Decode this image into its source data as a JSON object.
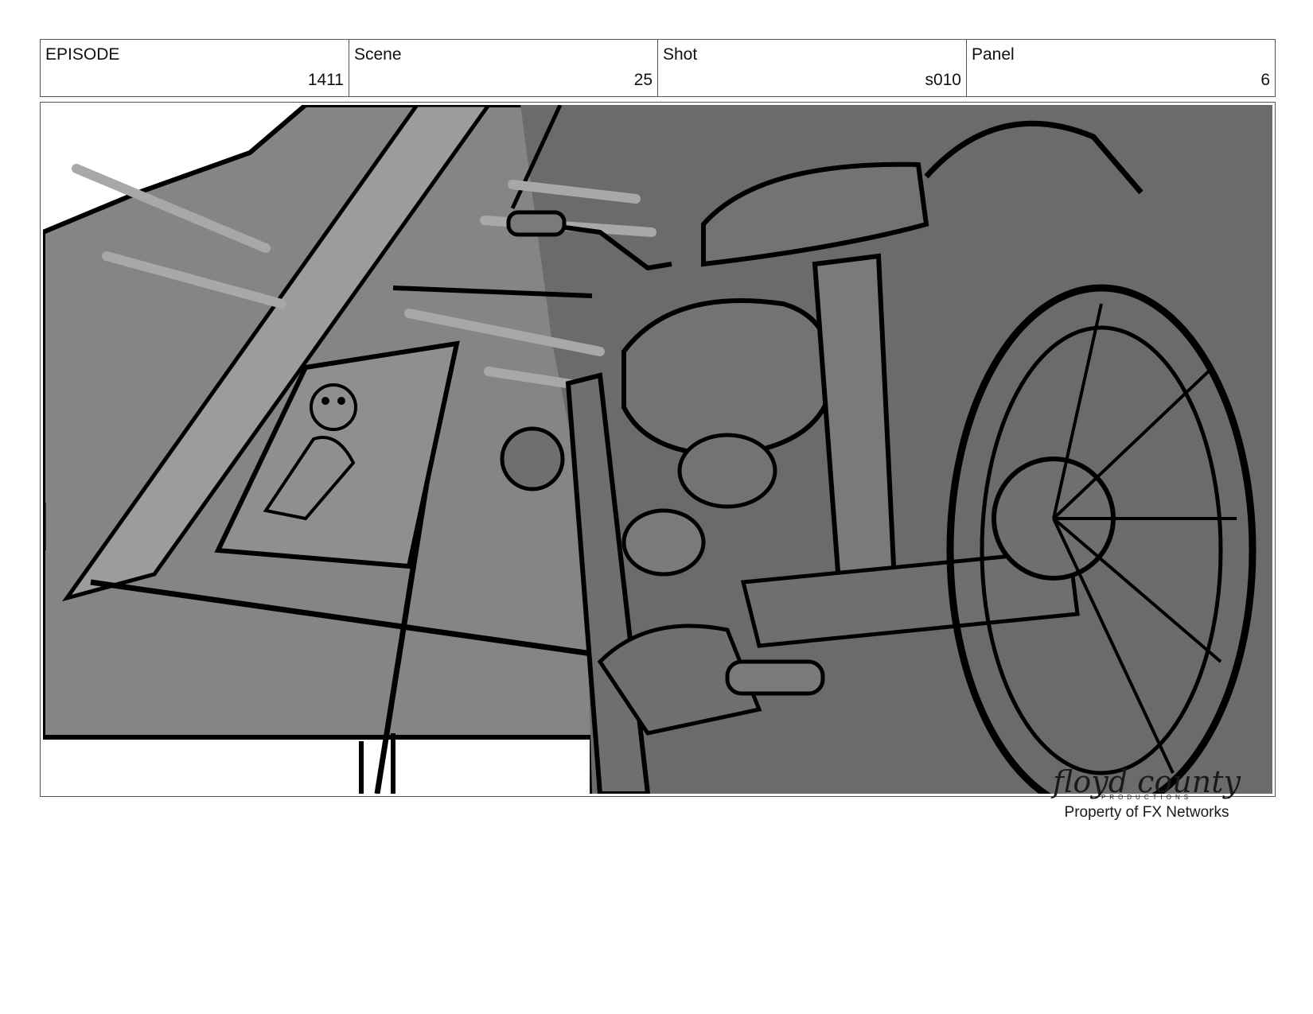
{
  "header": {
    "episode": {
      "label": "EPISODE",
      "value": "1411"
    },
    "scene": {
      "label": "Scene",
      "value": "25"
    },
    "shot": {
      "label": "Shot",
      "value": "s010"
    },
    "panel": {
      "label": "Panel",
      "value": "6"
    }
  },
  "watermark": {
    "logo": "floyd county",
    "logo_sub": "PRODUCTIONS",
    "text": "Property of FX Networks"
  },
  "colors": {
    "frame_border": "#555555",
    "sketch_dark": "#6b6b6b",
    "sketch_mid": "#858585",
    "sketch_light": "#9c9c9c",
    "ink": "#000000"
  }
}
